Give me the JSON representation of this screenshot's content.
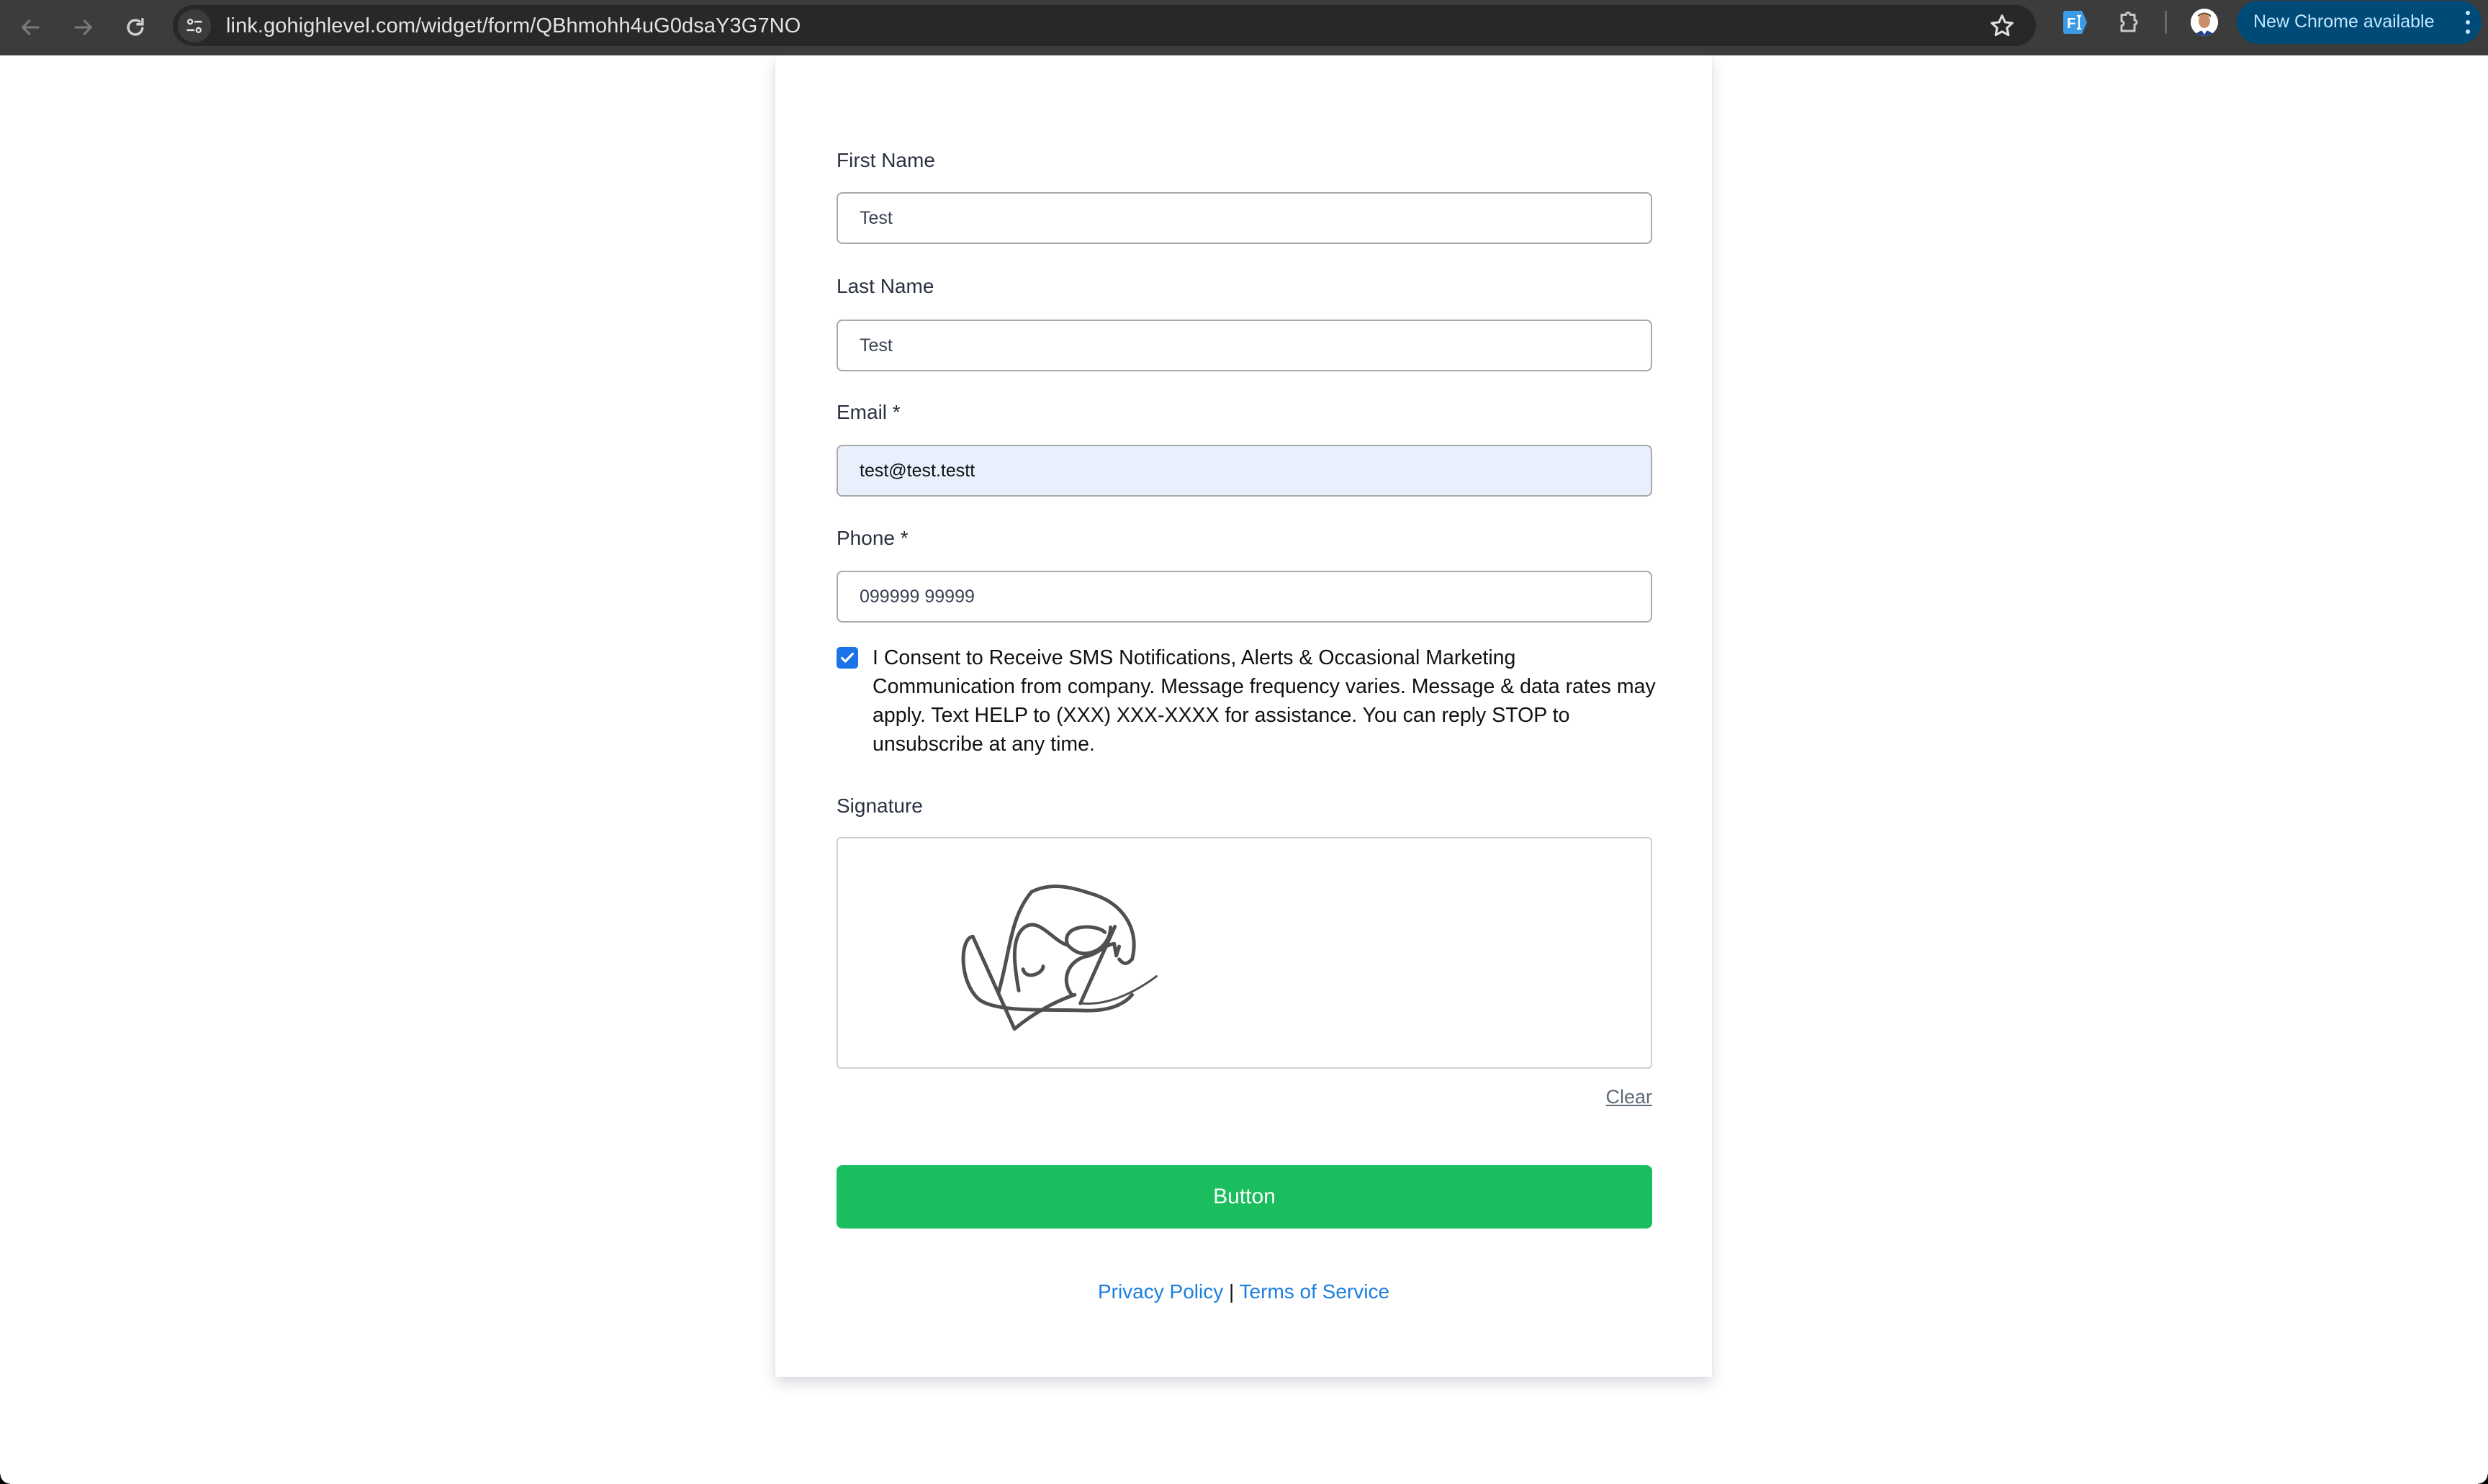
{
  "browser": {
    "url": "link.gohighlevel.com/widget/form/QBhmohh4uG0dsaY3G7NO",
    "update_label": "New Chrome available",
    "icons": {
      "back": "arrow-left-icon",
      "forward": "arrow-right-icon",
      "reload": "reload-icon",
      "site_info": "tune-icon",
      "bookmark": "star-icon",
      "extension_fi": "fi-extension-icon",
      "extensions": "puzzle-icon",
      "profile": "avatar",
      "menu": "kebab-menu-icon"
    }
  },
  "form": {
    "fields": [
      {
        "label": "First Name",
        "value": "Test"
      },
      {
        "label": "Last Name",
        "value": "Test"
      },
      {
        "label": "Email *",
        "value": "test@test.testt"
      },
      {
        "label": "Phone *",
        "value": "099999 99999"
      }
    ],
    "consent": {
      "checked": true,
      "text": "I Consent to Receive SMS Notifications, Alerts & Occasional Marketing Communication from company. Message frequency varies. Message & data rates may apply. Text HELP to (XXX) XXX-XXXX for assistance. You can reply STOP to unsubscribe at any time."
    },
    "signature": {
      "label": "Signature",
      "clear_label": "Clear",
      "has_signature": true
    },
    "submit_label": "Button",
    "links": {
      "privacy": "Privacy Policy",
      "separator": "|",
      "terms": "Terms of Service"
    }
  },
  "colors": {
    "button": "#1bbe5f",
    "link": "#1a7fe0",
    "checkbox": "#1a73e8",
    "autofill_bg": "#e8f0fe",
    "update_pill": "#004a77"
  }
}
